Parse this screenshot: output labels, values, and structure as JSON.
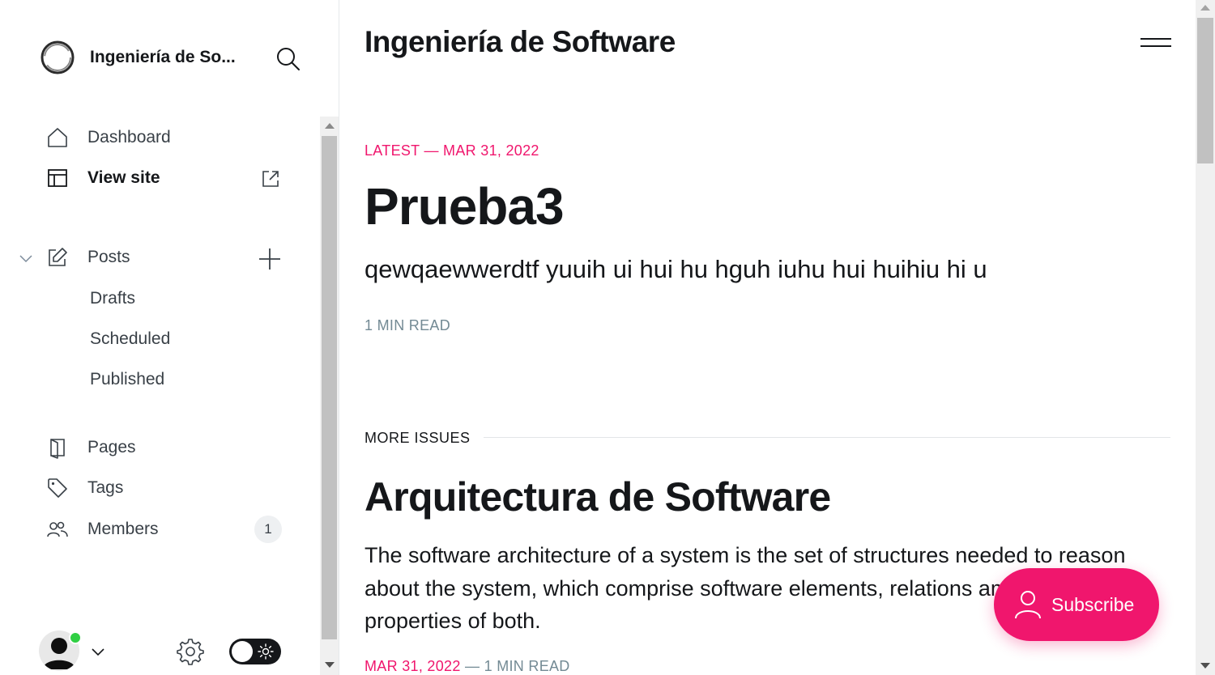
{
  "sidebar": {
    "site_name": "Ingeniería de So...",
    "nav": {
      "dashboard": "Dashboard",
      "view_site": "View site",
      "posts": "Posts",
      "drafts": "Drafts",
      "scheduled": "Scheduled",
      "published": "Published",
      "pages": "Pages",
      "tags": "Tags",
      "members": "Members",
      "members_count": "1"
    },
    "user_status": "online"
  },
  "main": {
    "site_title": "Ingeniería de Software",
    "latest": {
      "meta": "LATEST — MAR 31, 2022",
      "title": "Prueba3",
      "excerpt": "qewqaewwerdtf yuuih ui hui hu hguh iuhu hui huihiu hi u",
      "read_time": "1 MIN READ"
    },
    "more_issues_label": "MORE ISSUES",
    "post": {
      "title": "Arquitectura de Software",
      "excerpt": "The software architecture of a system is the set of structures needed to reason about the system, which comprise software elements, relations among them, and properties of both.",
      "date": "MAR 31, 2022",
      "read_time": "— 1 MIN READ"
    },
    "subscribe_label": "Subscribe"
  },
  "colors": {
    "accent": "#f0166d",
    "text": "#15171a",
    "muted": "#738a94",
    "online": "#30cf43"
  },
  "icons": [
    "ghost-logo-icon",
    "search-icon",
    "home-icon",
    "layout-icon",
    "external-link-icon",
    "chevron-down-icon",
    "edit-icon",
    "plus-icon",
    "page-icon",
    "tag-icon",
    "members-icon",
    "gear-icon",
    "sun-icon",
    "hamburger-icon",
    "user-icon"
  ]
}
